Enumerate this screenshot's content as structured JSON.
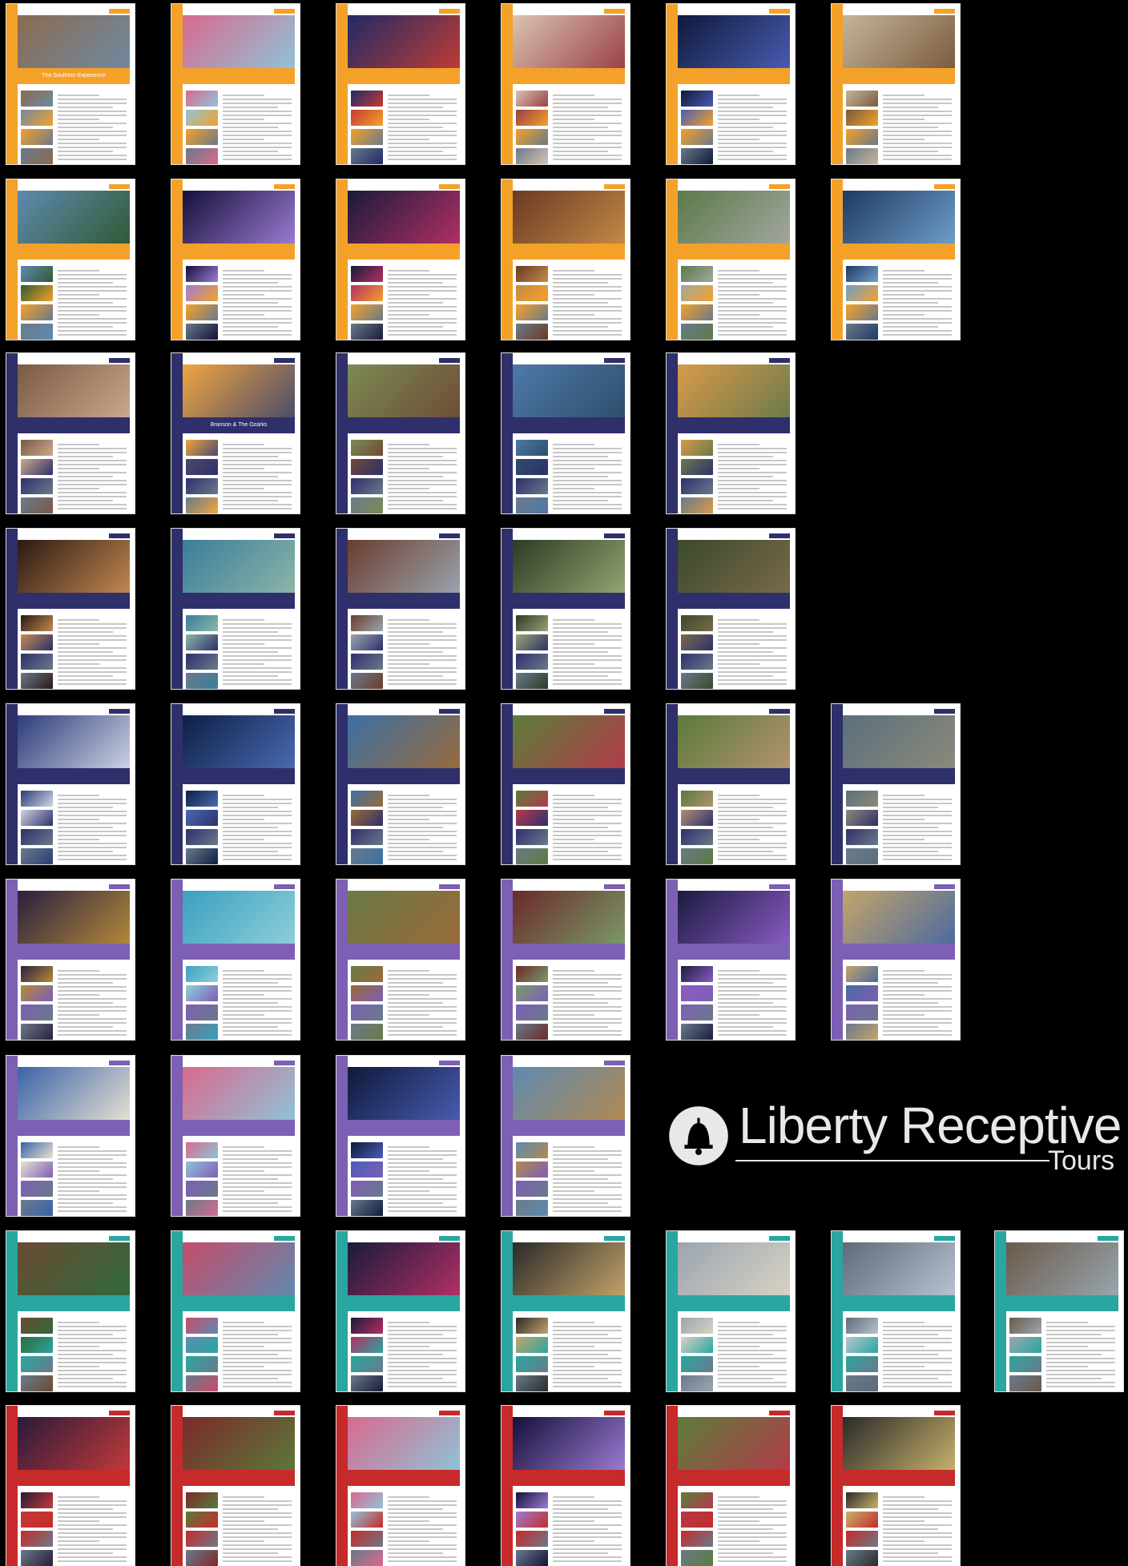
{
  "cards": [
    {
      "color": "#f4a12a",
      "title": "The Southern Experience",
      "hero": [
        "#8a6b50",
        "#6f8aa3"
      ]
    },
    {
      "color": "#f4a12a",
      "title": "",
      "hero": [
        "#d86a8e",
        "#8ec4d8"
      ]
    },
    {
      "color": "#f4a12a",
      "title": "",
      "hero": [
        "#1f2a66",
        "#c23c34"
      ]
    },
    {
      "color": "#f4a12a",
      "title": "",
      "hero": [
        "#d9c3b2",
        "#9a3f46"
      ]
    },
    {
      "color": "#f4a12a",
      "title": "",
      "hero": [
        "#0f1a3a",
        "#4a5cb4"
      ]
    },
    {
      "color": "#f4a12a",
      "title": "",
      "hero": [
        "#c4b59a",
        "#7a5a3e"
      ]
    },
    {
      "color": "#f4a12a",
      "title": "",
      "hero": [
        "#5f8ab0",
        "#2f5a32"
      ]
    },
    {
      "color": "#f4a12a",
      "title": "",
      "hero": [
        "#15103a",
        "#9d7cd4"
      ]
    },
    {
      "color": "#f4a12a",
      "title": "",
      "hero": [
        "#1a1a3a",
        "#b33066"
      ]
    },
    {
      "color": "#f4a12a",
      "title": "",
      "hero": [
        "#6a3a24",
        "#c48a46"
      ]
    },
    {
      "color": "#f4a12a",
      "title": "",
      "hero": [
        "#5c7a4a",
        "#a3a7a0"
      ]
    },
    {
      "color": "#f4a12a",
      "title": "",
      "hero": [
        "#1f3a66",
        "#6fa0c8"
      ]
    },
    {
      "color": "#2f2f6b",
      "title": "",
      "hero": [
        "#7a5a44",
        "#caa98e"
      ]
    },
    {
      "color": "#2f2f6b",
      "title": "Branson & The Ozarks",
      "hero": [
        "#f0a640",
        "#4a4a6a"
      ]
    },
    {
      "color": "#2f2f6b",
      "title": "",
      "hero": [
        "#7b8c55",
        "#6e4a34"
      ]
    },
    {
      "color": "#2f2f6b",
      "title": "",
      "hero": [
        "#4e79a8",
        "#2d4e6b"
      ]
    },
    {
      "color": "#2f2f6b",
      "title": "",
      "hero": [
        "#d89a4a",
        "#6a7a4a"
      ]
    },
    {
      "color": "#2f2f6b",
      "title": "",
      "hero": [
        "#2a1a12",
        "#c38a52"
      ]
    },
    {
      "color": "#2f2f6b",
      "title": "",
      "hero": [
        "#3a7d9a",
        "#8db6a7"
      ]
    },
    {
      "color": "#2f2f6b",
      "title": "",
      "hero": [
        "#6b3d2d",
        "#9aa5b0"
      ]
    },
    {
      "color": "#2f2f6b",
      "title": "",
      "hero": [
        "#2d3b24",
        "#96a574"
      ]
    },
    {
      "color": "#2f2f6b",
      "title": "",
      "hero": [
        "#3a4a2b",
        "#7a6a4b"
      ]
    },
    {
      "color": "#2f2f6b",
      "title": "",
      "hero": [
        "#2d3c7a",
        "#cfd4e6"
      ]
    },
    {
      "color": "#2f2f6b",
      "title": "",
      "hero": [
        "#0e1f45",
        "#4a6bb3"
      ]
    },
    {
      "color": "#2f2f6b",
      "title": "",
      "hero": [
        "#3b70a5",
        "#9a6a3a"
      ]
    },
    {
      "color": "#2f2f6b",
      "title": "",
      "hero": [
        "#5b7d3a",
        "#b43a4a"
      ]
    },
    {
      "color": "#2f2f6b",
      "title": "",
      "hero": [
        "#5a7a3b",
        "#b49270"
      ]
    },
    {
      "color": "#2f2f6b",
      "title": "",
      "hero": [
        "#5b6f7d",
        "#8c8a7a"
      ]
    },
    {
      "color": "#7d5fb4",
      "title": "",
      "hero": [
        "#2a1f3f",
        "#b58a3a"
      ]
    },
    {
      "color": "#7d5fb4",
      "title": "",
      "hero": [
        "#3aa0c0",
        "#8fcfda"
      ]
    },
    {
      "color": "#7d5fb4",
      "title": "",
      "hero": [
        "#6a7a45",
        "#9a6a3a"
      ]
    },
    {
      "color": "#7d5fb4",
      "title": "",
      "hero": [
        "#6a2a2a",
        "#7a9a6a"
      ]
    },
    {
      "color": "#7d5fb4",
      "title": "",
      "hero": [
        "#1b1b3f",
        "#8a5cc4"
      ]
    },
    {
      "color": "#7d5fb4",
      "title": "",
      "hero": [
        "#c4a46a",
        "#4a6aa0"
      ]
    },
    {
      "color": "#7d5fb4",
      "title": "",
      "hero": [
        "#3b63a8",
        "#e8e2d2"
      ]
    },
    {
      "color": "#7d5fb4",
      "title": "",
      "hero": [
        "#d86a8e",
        "#8ec4d8"
      ]
    },
    {
      "color": "#7d5fb4",
      "title": "",
      "hero": [
        "#0f1a3a",
        "#4a5cb4"
      ]
    },
    {
      "color": "#7d5fb4",
      "title": "",
      "hero": [
        "#5f8ab0",
        "#b08a50"
      ]
    },
    {
      "color": "#2aa6a0",
      "title": "",
      "hero": [
        "#6a4a34",
        "#2f6a3a"
      ]
    },
    {
      "color": "#2aa6a0",
      "title": "",
      "hero": [
        "#c54c6a",
        "#5f8ab0"
      ]
    },
    {
      "color": "#2aa6a0",
      "title": "",
      "hero": [
        "#1a1a3a",
        "#b33066"
      ]
    },
    {
      "color": "#2aa6a0",
      "title": "",
      "hero": [
        "#2a2a2a",
        "#c4a46a"
      ]
    },
    {
      "color": "#2aa6a0",
      "title": "",
      "hero": [
        "#9aa5b0",
        "#d8d2c4"
      ]
    },
    {
      "color": "#2aa6a0",
      "title": "",
      "hero": [
        "#5f6a7a",
        "#b8c4d0"
      ]
    },
    {
      "color": "#2aa6a0",
      "title": "",
      "hero": [
        "#6a5a4a",
        "#9aa7b0"
      ]
    },
    {
      "color": "#c62a2a",
      "title": "",
      "hero": [
        "#2a1a3a",
        "#c43a3a"
      ]
    },
    {
      "color": "#c62a2a",
      "title": "",
      "hero": [
        "#7a2a2a",
        "#5a7a3a"
      ]
    },
    {
      "color": "#c62a2a",
      "title": "",
      "hero": [
        "#d86a8e",
        "#8ec4d8"
      ]
    },
    {
      "color": "#c62a2a",
      "title": "",
      "hero": [
        "#15103a",
        "#9d7cd4"
      ]
    },
    {
      "color": "#c62a2a",
      "title": "",
      "hero": [
        "#5b7d3a",
        "#b43a4a"
      ]
    },
    {
      "color": "#c62a2a",
      "title": "",
      "hero": [
        "#2a2a2a",
        "#c9b36a"
      ]
    }
  ],
  "logo": {
    "name": "Liberty Receptive",
    "sub": "Tours"
  }
}
